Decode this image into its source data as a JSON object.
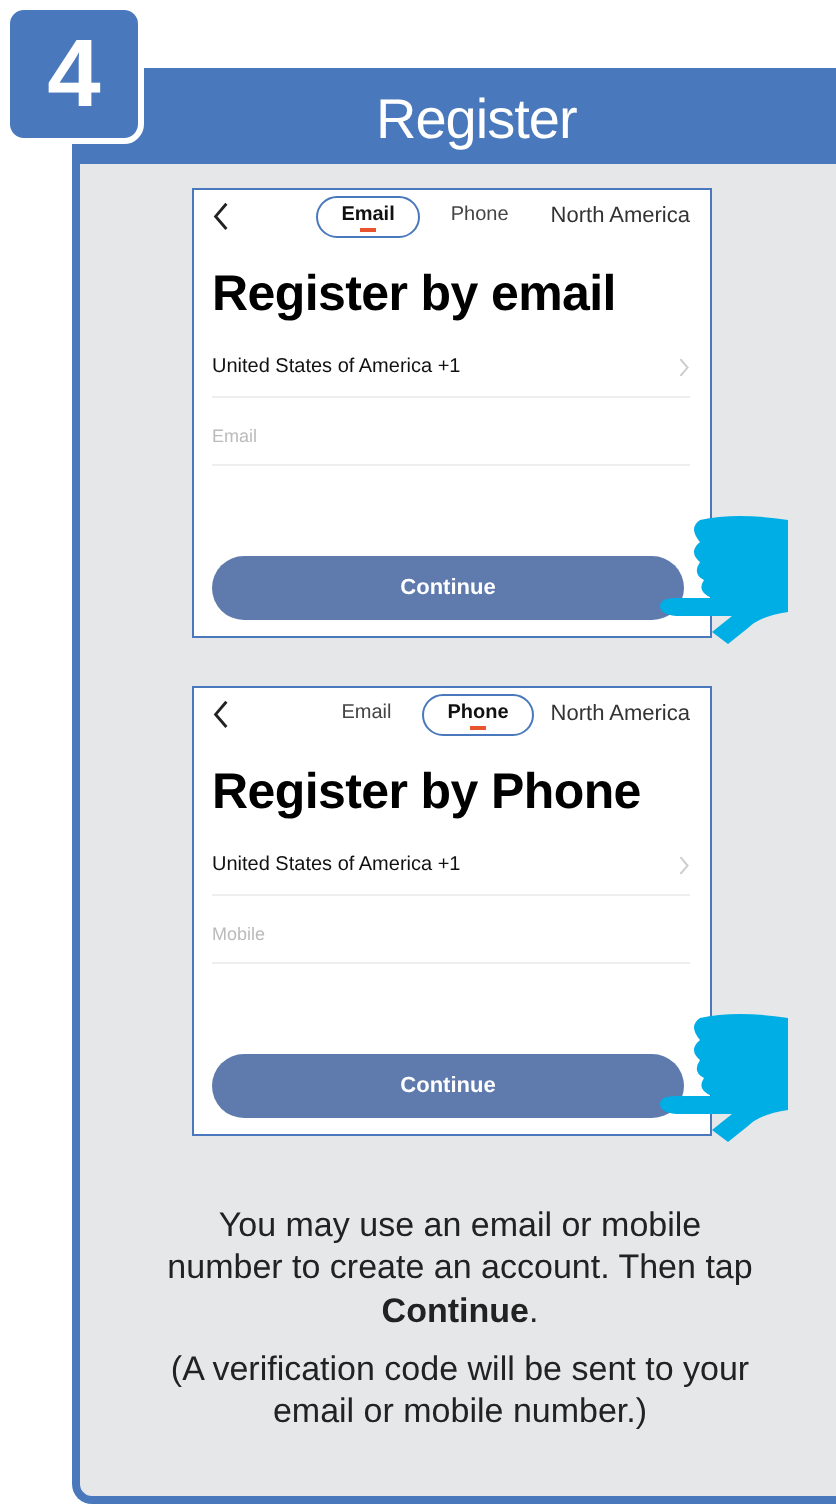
{
  "step": "4",
  "header": "Register",
  "screens": [
    {
      "tabs": [
        {
          "label": "Email",
          "selected": true
        },
        {
          "label": "Phone",
          "selected": false
        }
      ],
      "region": "North America",
      "title": "Register by email",
      "country": "United States of America +1",
      "input": {
        "placeholder": "Email"
      },
      "button": "Continue"
    },
    {
      "tabs": [
        {
          "label": "Email",
          "selected": false
        },
        {
          "label": "Phone",
          "selected": true
        }
      ],
      "region": "North America",
      "title": "Register by Phone",
      "country": "United States of America +1",
      "input": {
        "placeholder": "Mobile"
      },
      "button": "Continue"
    }
  ],
  "instructions": [
    "You may use an email or mobile number to create an account. Then tap **Continue**.",
    "(A verification code will be sent to your email or mobile number.)"
  ]
}
